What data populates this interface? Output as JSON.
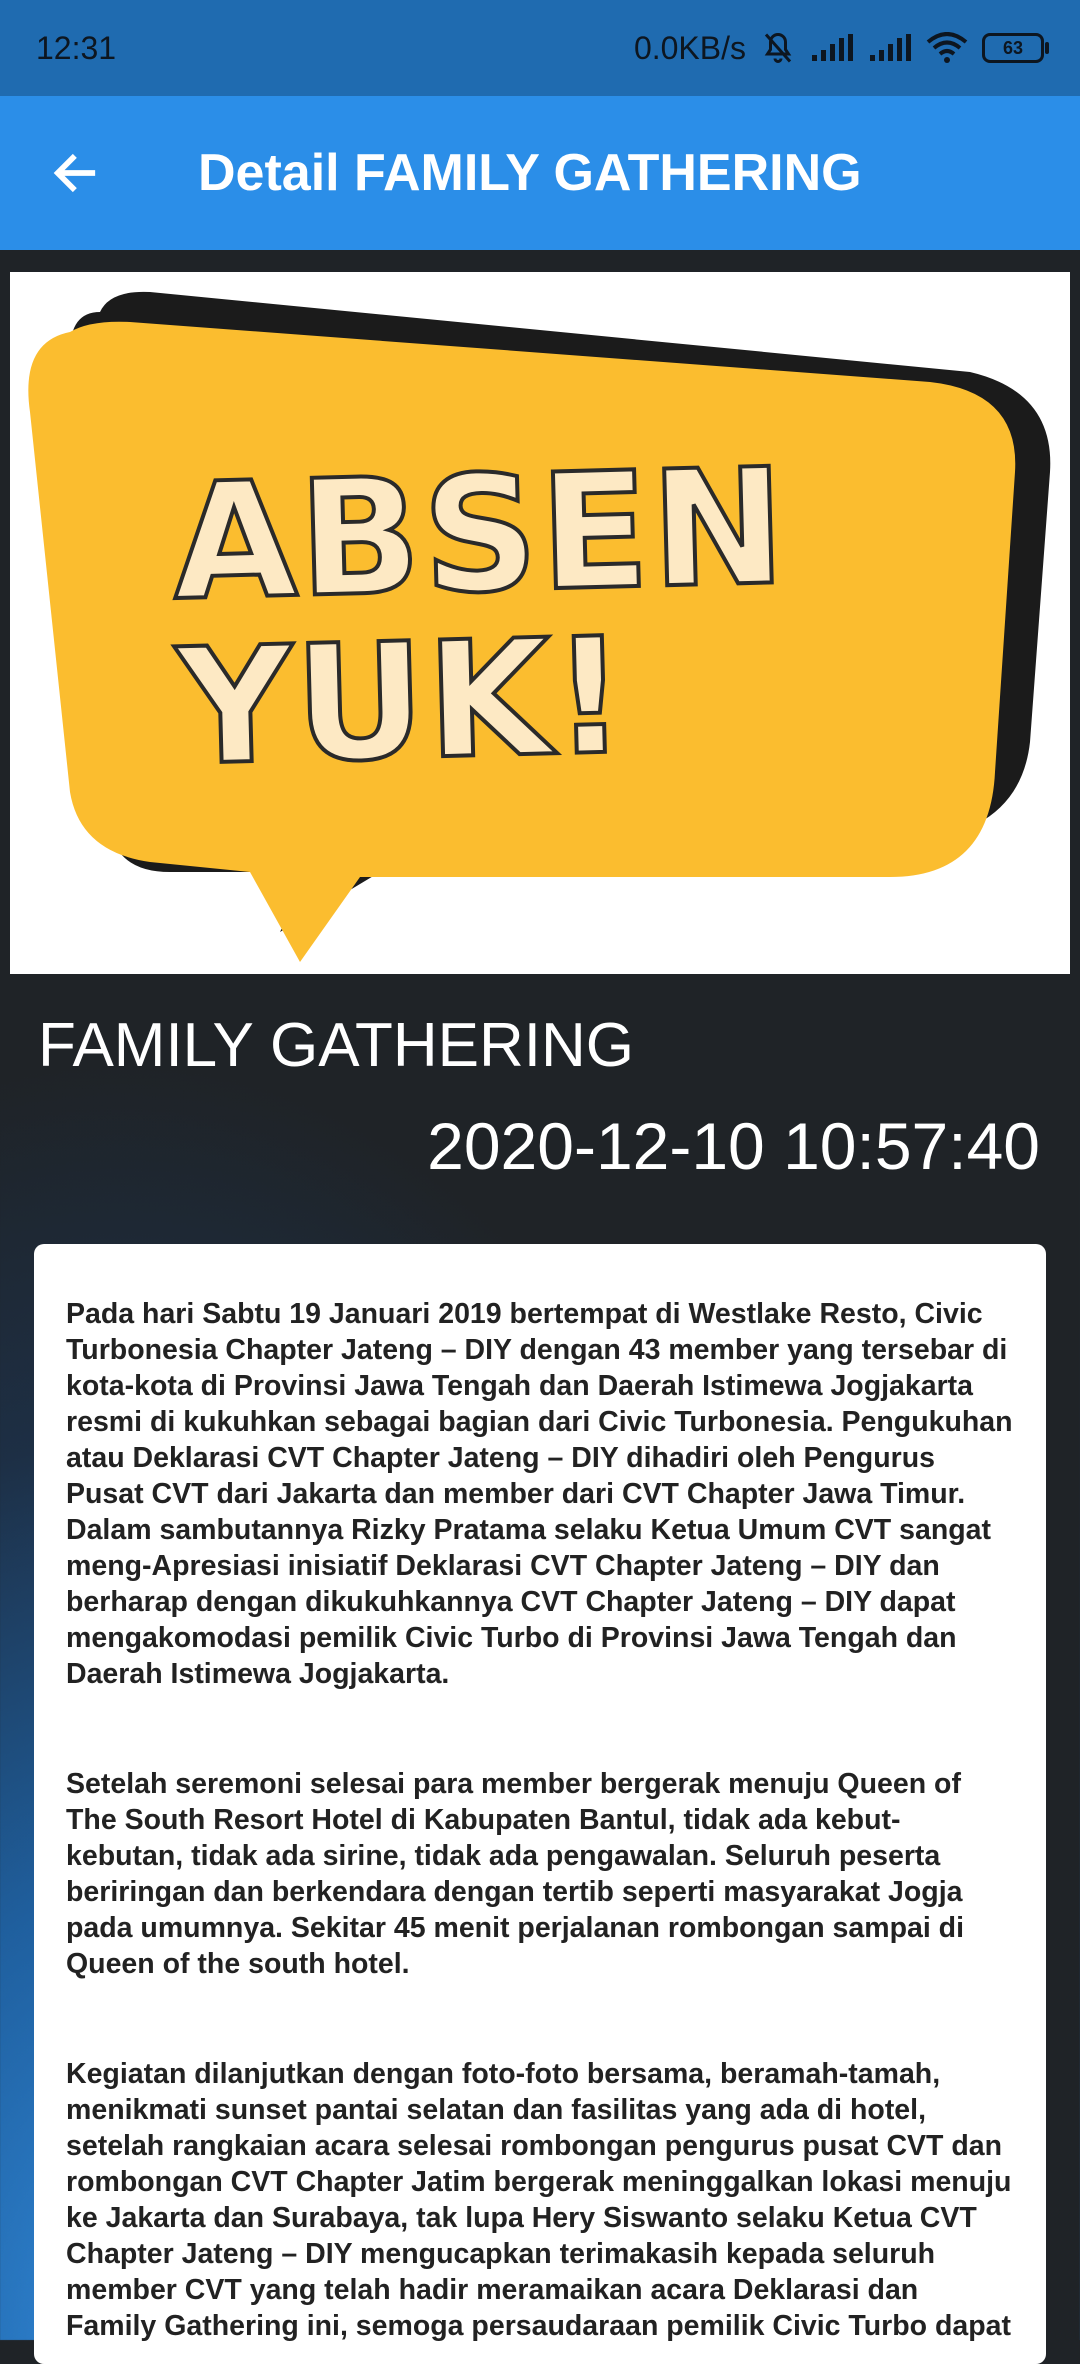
{
  "status_bar": {
    "time": "12:31",
    "network_speed": "0.0KB/s",
    "battery_level": "63",
    "icons": [
      "bell-off-icon",
      "signal-icon",
      "signal-icon",
      "wifi-icon",
      "battery-icon"
    ]
  },
  "app_bar": {
    "back_icon": "arrow-left-icon",
    "title": "Detail FAMILY GATHERING",
    "color": "#2b8ee8"
  },
  "banner": {
    "line1": "ABSEN",
    "line2": "YUK!",
    "bubble_color": "#fbbd2f",
    "text_fill": "#fde9c4"
  },
  "event": {
    "title": "FAMILY GATHERING",
    "datetime": "2020-12-10 10:57:40"
  },
  "content": {
    "paragraphs": [
      "Pada hari Sabtu 19 Januari 2019 bertempat di Westlake Resto, Civic\nTurbonesia Chapter Jateng – DIY dengan 43 member yang tersebar di\nkota-kota di Provinsi Jawa Tengah dan Daerah Istimewa Jogjakarta\nresmi di kukuhkan sebagai bagian dari Civic Turbonesia. Pengukuhan\natau Deklarasi CVT Chapter Jateng – DIY dihadiri oleh Pengurus\nPusat CVT dari Jakarta dan member dari CVT Chapter Jawa Timur.\nDalam sambutannya Rizky Pratama selaku Ketua Umum CVT sangat\nmeng-Apresiasi inisiatif Deklarasi CVT Chapter Jateng – DIY dan\nberharap dengan dikukuhkannya CVT Chapter Jateng – DIY dapat\nmengakomodasi pemilik Civic Turbo di Provinsi Jawa Tengah dan\nDaerah Istimewa Jogjakarta.",
      "Setelah seremoni selesai para member bergerak menuju Queen of\nThe South Resort Hotel di Kabupaten Bantul, tidak ada kebut-\nkebutan, tidak ada sirine, tidak ada pengawalan. Seluruh peserta\nberiringan dan berkendara dengan tertib seperti masyarakat Jogja\npada umumnya. Sekitar 45 menit perjalanan rombongan sampai di\nQueen of the south hotel.",
      "Kegiatan dilanjutkan dengan foto-foto bersama, beramah-tamah,\nmenikmati sunset pantai selatan dan fasilitas yang ada di hotel,\n setelah rangkaian acara selesai rombongan pengurus pusat CVT dan\nrombongan CVT Chapter Jatim bergerak meninggalkan lokasi menuju\nke Jakarta dan Surabaya, tak lupa Hery Siswanto selaku Ketua CVT\nChapter Jateng – DIY mengucapkan terimakasih kepada seluruh\nmember CVT yang telah hadir meramaikan acara Deklarasi dan\nFamily Gathering ini, semoga persaudaraan pemilik Civic Turbo dapat"
    ]
  }
}
